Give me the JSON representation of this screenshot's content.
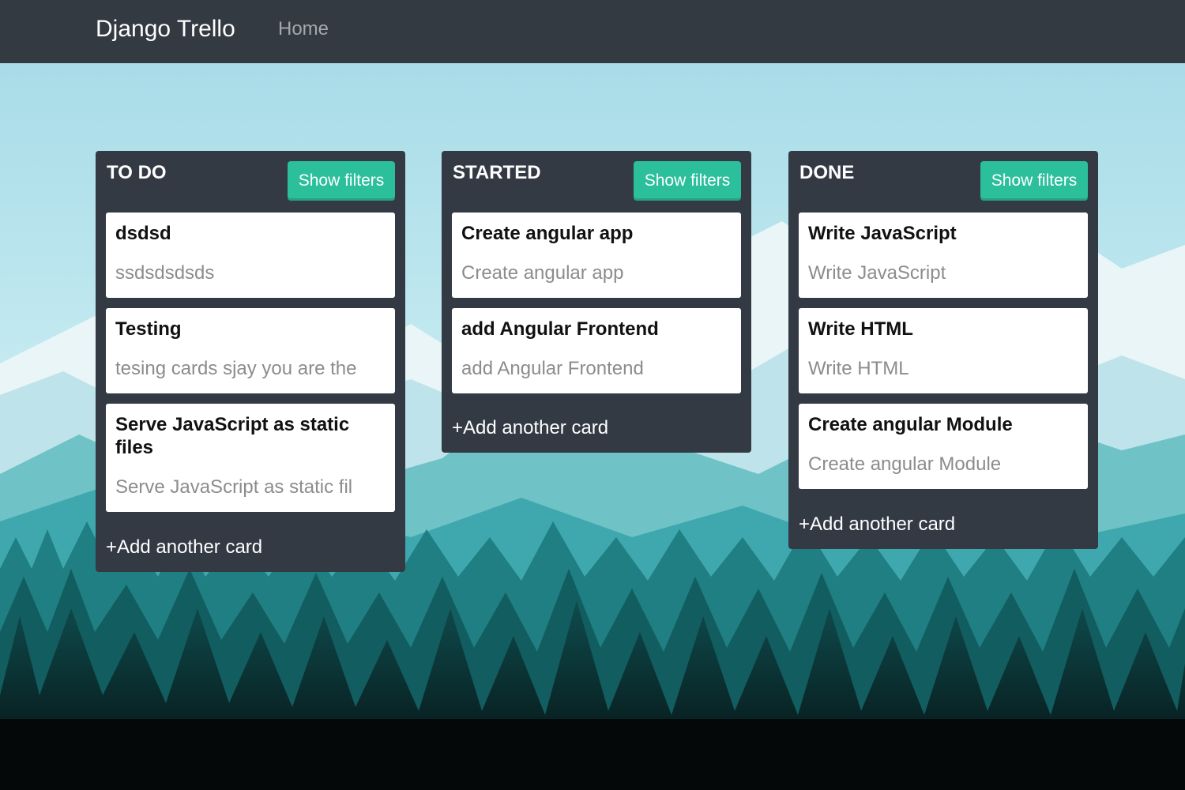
{
  "navbar": {
    "brand": "Django Trello",
    "home_link": "Home"
  },
  "lists": [
    {
      "title": "TO DO",
      "filter_label": "Show filters",
      "add_label": "+Add another card",
      "cards": [
        {
          "title": "dsdsd",
          "description": "ssdsdsdsds"
        },
        {
          "title": "Testing",
          "description": "tesing cards sjay you are the"
        },
        {
          "title": "Serve JavaScript as static files",
          "description": "Serve JavaScript as static fil"
        }
      ]
    },
    {
      "title": "STARTED",
      "filter_label": "Show filters",
      "add_label": "+Add another card",
      "cards": [
        {
          "title": "Create angular app",
          "description": "Create angular app"
        },
        {
          "title": "add Angular Frontend",
          "description": "add Angular Frontend"
        }
      ]
    },
    {
      "title": "DONE",
      "filter_label": "Show filters",
      "add_label": "+Add another card",
      "cards": [
        {
          "title": "Write JavaScript",
          "description": "Write JavaScript"
        },
        {
          "title": "Write HTML",
          "description": "Write HTML"
        },
        {
          "title": "Create angular Module",
          "description": "Create angular Module"
        }
      ]
    }
  ],
  "colors": {
    "navbar": "#343a42",
    "list_bg": "#333a44",
    "accent": "#2bbf9b",
    "sky": "#a9dde8",
    "forest": "#0c3a3c"
  }
}
